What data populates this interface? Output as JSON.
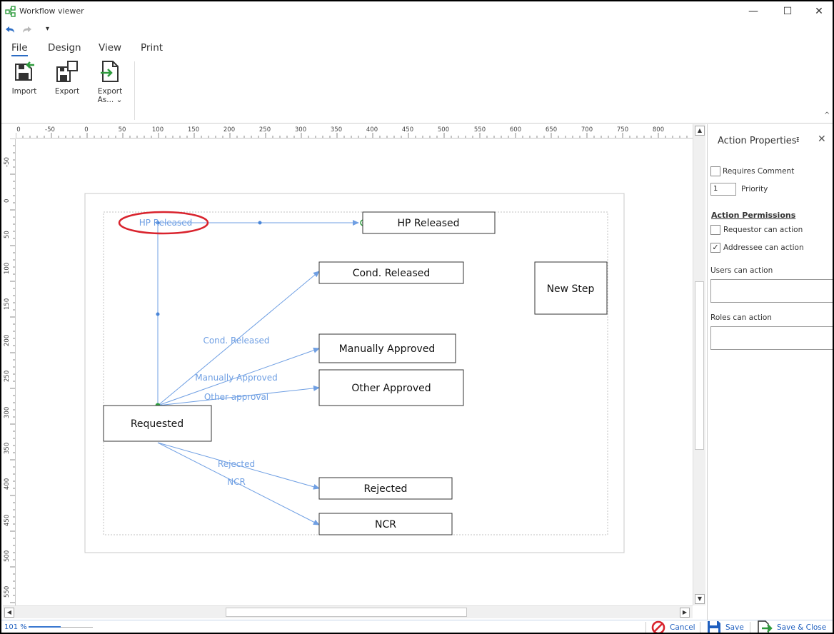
{
  "window": {
    "title": "Workflow viewer",
    "min": "—",
    "max": "☐",
    "close": "✕"
  },
  "quick_access": {
    "undo_icon": "undo-icon",
    "redo_icon": "redo-icon",
    "dropdown": "▾"
  },
  "tabs": [
    {
      "label": "File",
      "active": true
    },
    {
      "label": "Design"
    },
    {
      "label": "View"
    },
    {
      "label": "Print"
    }
  ],
  "ribbon": {
    "import_label": "Import",
    "export_label": "Export",
    "export_as_line1": "Export",
    "export_as_line2": "As... ⌄",
    "collapse": "^"
  },
  "ruler": {
    "top": [
      "0",
      "-50",
      "0",
      "50",
      "100",
      "150",
      "200",
      "250",
      "300",
      "350",
      "400",
      "450",
      "500",
      "550",
      "600",
      "650",
      "700",
      "750",
      "800"
    ],
    "left": [
      "-50",
      "0",
      "50",
      "100",
      "150",
      "200",
      "250",
      "300",
      "350",
      "400",
      "450",
      "500",
      "550"
    ]
  },
  "diagram": {
    "steps": {
      "hp_released": "HP Released",
      "cond_released": "Cond. Released",
      "new_step": "New Step",
      "manually_approved": "Manually Approved",
      "other_approved": "Other Approved",
      "requested": "Requested",
      "rejected": "Rejected",
      "ncr": "NCR"
    },
    "actions": {
      "hp_released": "HP Released",
      "cond_released": "Cond. Released",
      "manually_approved": "Manually Approved",
      "other_approval": "Other approval",
      "rejected": "Rejected",
      "ncr": "NCR"
    },
    "highlight_color": "#d9232d",
    "edge_color": "#6f9fe3"
  },
  "properties": {
    "title": "Action Properties",
    "pin": "ᵻ",
    "close": "✕",
    "requires_comment": {
      "label": "Requires Comment",
      "checked": false
    },
    "priority": {
      "value": "1",
      "label": "Priority"
    },
    "permissions_heading": "Action Permissions",
    "requestor": {
      "label": "Requestor can action",
      "checked": false
    },
    "addressee": {
      "label": "Addressee can action",
      "checked": true,
      "mark": "✓"
    },
    "users_label": "Users can action",
    "roles_label": "Roles can action"
  },
  "statusbar": {
    "zoom": "101 %",
    "zoom_level": 0.5,
    "cancel": "Cancel",
    "save": "Save",
    "save_close": "Save & Close"
  }
}
